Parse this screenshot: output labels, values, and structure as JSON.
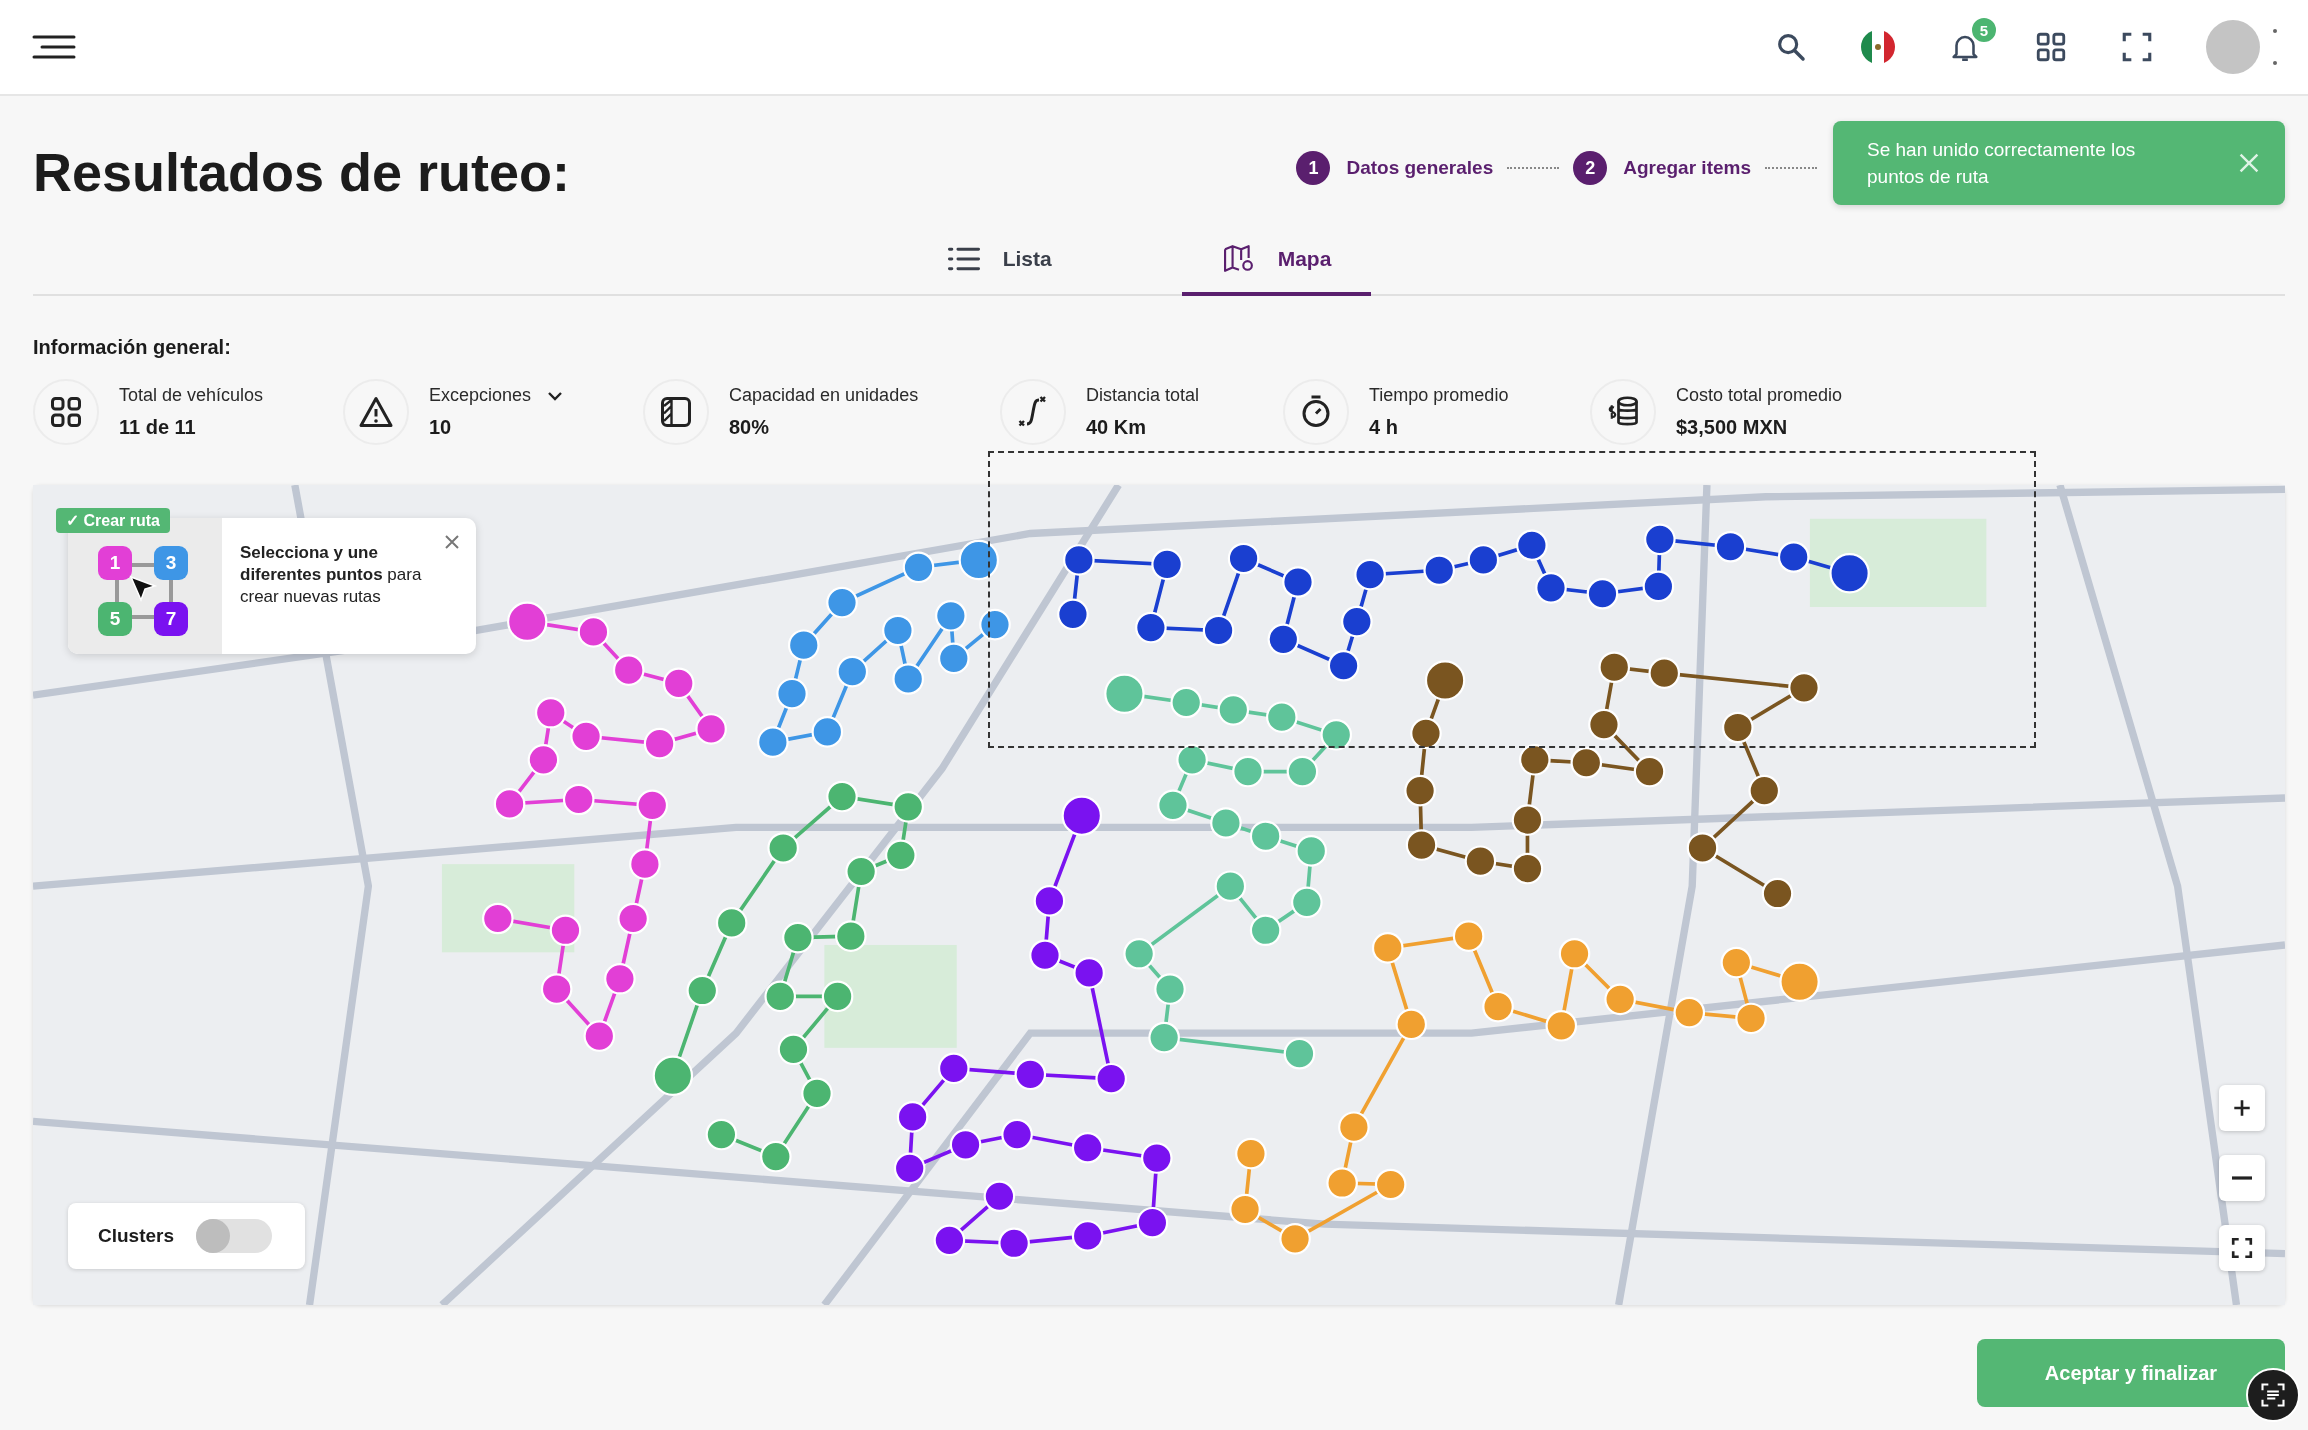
{
  "header": {
    "notifications": "5"
  },
  "title": "Resultados de ruteo:",
  "stepper": [
    {
      "number": "1",
      "label": "Datos generales"
    },
    {
      "number": "2",
      "label": "Agregar items"
    }
  ],
  "toast": {
    "message": "Se han unido correctamente los puntos de ruta"
  },
  "tabs": [
    {
      "label": "Lista",
      "kind": "list",
      "selected": false
    },
    {
      "label": "Mapa",
      "kind": "map",
      "selected": true
    }
  ],
  "info": {
    "heading": "Información general:",
    "stats": [
      {
        "kind": "vehicles",
        "label": "Total de vehículos",
        "value": "11 de 11",
        "dropdown": false
      },
      {
        "kind": "warning",
        "label": "Excepciones",
        "value": "10",
        "dropdown": true
      },
      {
        "kind": "capacity",
        "label": "Capacidad en unidades",
        "value": "80%",
        "dropdown": false
      },
      {
        "kind": "distance",
        "label": "Distancia total",
        "value": "40 Km",
        "dropdown": false
      },
      {
        "kind": "time",
        "label": "Tiempo promedio",
        "value": "4 h",
        "dropdown": false
      },
      {
        "kind": "cost",
        "label": "Costo total promedio",
        "value": "$3,500 MXN",
        "dropdown": false
      }
    ]
  },
  "tutorial": {
    "badge": "✓ Crear ruta",
    "points": [
      {
        "number": "1",
        "color": "#e23fd6"
      },
      {
        "number": "3",
        "color": "#3e96e6"
      },
      {
        "number": "5",
        "color": "#4cb571"
      },
      {
        "number": "7",
        "color": "#7a12f0"
      }
    ],
    "text": "**Selecciona y une diferentes puntos** para crear nuevas rutas"
  },
  "clusters": {
    "label": "Clusters",
    "on": false
  },
  "accept_button": "Aceptar y finalizar"
}
